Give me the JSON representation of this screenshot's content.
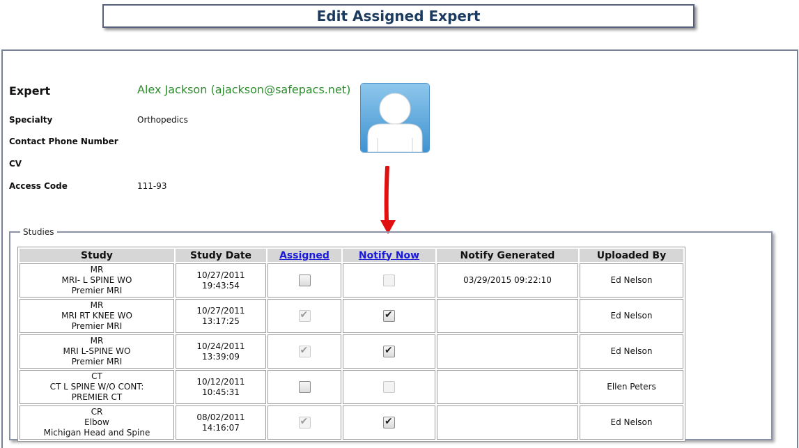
{
  "page_title": "Edit Assigned Expert",
  "expert": {
    "label": "Expert",
    "name": "Alex Jackson (ajackson@safepacs.net)",
    "specialty_label": "Specialty",
    "specialty": "Orthopedics",
    "phone_label": "Contact Phone Number",
    "cv_label": "CV",
    "access_code_label": "Access Code",
    "access_code": "111-93"
  },
  "studies": {
    "legend": "Studies",
    "headers": {
      "study": "Study",
      "study_date": "Study Date",
      "assigned": "Assigned",
      "notify_now": "Notify Now",
      "notify_generated": "Notify Generated",
      "uploaded_by": "Uploaded By"
    },
    "rows": [
      {
        "mod": "MR",
        "desc": "MRI- L SPINE WO",
        "site": "Premier MRI",
        "date": "10/27/2011",
        "time": "19:43:54",
        "assigned": false,
        "assigned_disabled": false,
        "notify": false,
        "notify_disabled": true,
        "generated": "03/29/2015 09:22:10",
        "uploaded_by": "Ed Nelson"
      },
      {
        "mod": "MR",
        "desc": "MRI RT KNEE WO",
        "site": "Premier MRI",
        "date": "10/27/2011",
        "time": "13:17:25",
        "assigned": true,
        "assigned_disabled": true,
        "notify": true,
        "notify_disabled": false,
        "generated": "",
        "uploaded_by": "Ed Nelson"
      },
      {
        "mod": "MR",
        "desc": "MRI L-SPINE WO",
        "site": "Premier MRI",
        "date": "10/24/2011",
        "time": "13:39:09",
        "assigned": true,
        "assigned_disabled": true,
        "notify": true,
        "notify_disabled": false,
        "generated": "",
        "uploaded_by": "Ed Nelson"
      },
      {
        "mod": "CT",
        "desc": "CT L SPINE W/O CONT:",
        "site": "PREMIER CT",
        "date": "10/12/2011",
        "time": "10:45:31",
        "assigned": false,
        "assigned_disabled": false,
        "notify": false,
        "notify_disabled": true,
        "generated": "",
        "uploaded_by": "Ellen Peters"
      },
      {
        "mod": "CR",
        "desc": "Elbow",
        "site": "Michigan Head and Spine",
        "date": "08/02/2011",
        "time": "14:16:07",
        "assigned": true,
        "assigned_disabled": true,
        "notify": true,
        "notify_disabled": false,
        "generated": "",
        "uploaded_by": "Ed Nelson"
      }
    ]
  },
  "colors": {
    "accent_link": "#1a1adb",
    "expert_name": "#2e8b2e",
    "arrow": "#e01010",
    "title": "#1c3a5e"
  },
  "icons": {
    "avatar": "user-silhouette-icon",
    "arrow": "red-down-arrow-icon",
    "check": "check-mark-icon"
  }
}
